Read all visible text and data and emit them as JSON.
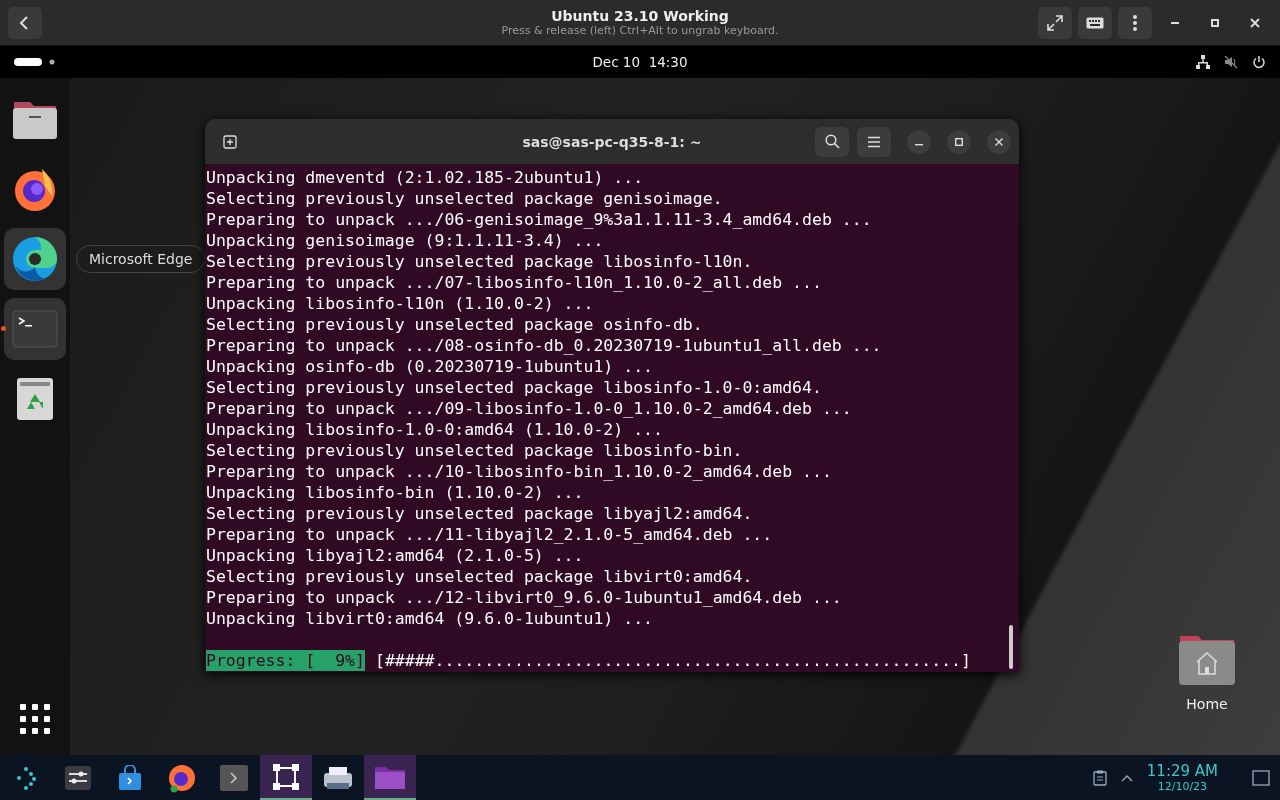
{
  "viewer": {
    "title": "Ubuntu 23.10 Working",
    "subtitle": "Press & release (left) Ctrl+Alt to ungrab keyboard."
  },
  "top_bar": {
    "clock": "Dec 10  14:30"
  },
  "dock": {
    "items": [
      {
        "kind": "files",
        "highlighted": false,
        "running": false
      },
      {
        "kind": "firefox",
        "highlighted": false,
        "running": false
      },
      {
        "kind": "edge",
        "highlighted": true,
        "running": false,
        "tooltip": "Microsoft Edge"
      },
      {
        "kind": "terminal",
        "highlighted": true,
        "running": true
      },
      {
        "kind": "trash",
        "highlighted": false,
        "running": false
      }
    ]
  },
  "terminal": {
    "title": "sas@sas-pc-q35-8-1: ~",
    "lines": [
      "Unpacking dmeventd (2:1.02.185-2ubuntu1) ...",
      "Selecting previously unselected package genisoimage.",
      "Preparing to unpack .../06-genisoimage_9%3a1.1.11-3.4_amd64.deb ...",
      "Unpacking genisoimage (9:1.1.11-3.4) ...",
      "Selecting previously unselected package libosinfo-l10n.",
      "Preparing to unpack .../07-libosinfo-l10n_1.10.0-2_all.deb ...",
      "Unpacking libosinfo-l10n (1.10.0-2) ...",
      "Selecting previously unselected package osinfo-db.",
      "Preparing to unpack .../08-osinfo-db_0.20230719-1ubuntu1_all.deb ...",
      "Unpacking osinfo-db (0.20230719-1ubuntu1) ...",
      "Selecting previously unselected package libosinfo-1.0-0:amd64.",
      "Preparing to unpack .../09-libosinfo-1.0-0_1.10.0-2_amd64.deb ...",
      "Unpacking libosinfo-1.0-0:amd64 (1.10.0-2) ...",
      "Selecting previously unselected package libosinfo-bin.",
      "Preparing to unpack .../10-libosinfo-bin_1.10.0-2_amd64.deb ...",
      "Unpacking libosinfo-bin (1.10.0-2) ...",
      "Selecting previously unselected package libyajl2:amd64.",
      "Preparing to unpack .../11-libyajl2_2.1.0-5_amd64.deb ...",
      "Unpacking libyajl2:amd64 (2.1.0-5) ...",
      "Selecting previously unselected package libvirt0:amd64.",
      "Preparing to unpack .../12-libvirt0_9.6.0-1ubuntu1_amd64.deb ...",
      "Unpacking libvirt0:amd64 (9.6.0-1ubuntu1) ..."
    ],
    "progress_label": "Progress: [  9%]",
    "progress_bar": "[#####.....................................................]"
  },
  "desktop_icons": [
    {
      "label": "Home"
    }
  ],
  "taskbar": {
    "items": [
      {
        "kind": "launcher",
        "active": false
      },
      {
        "kind": "settings",
        "active": false
      },
      {
        "kind": "store",
        "active": false
      },
      {
        "kind": "firefox",
        "active": false
      },
      {
        "kind": "terminal",
        "active": false
      },
      {
        "kind": "frame",
        "active": true
      },
      {
        "kind": "scanner",
        "active": false
      },
      {
        "kind": "folder",
        "active": true
      }
    ],
    "time": "11:29 AM",
    "date": "12/10/23"
  }
}
